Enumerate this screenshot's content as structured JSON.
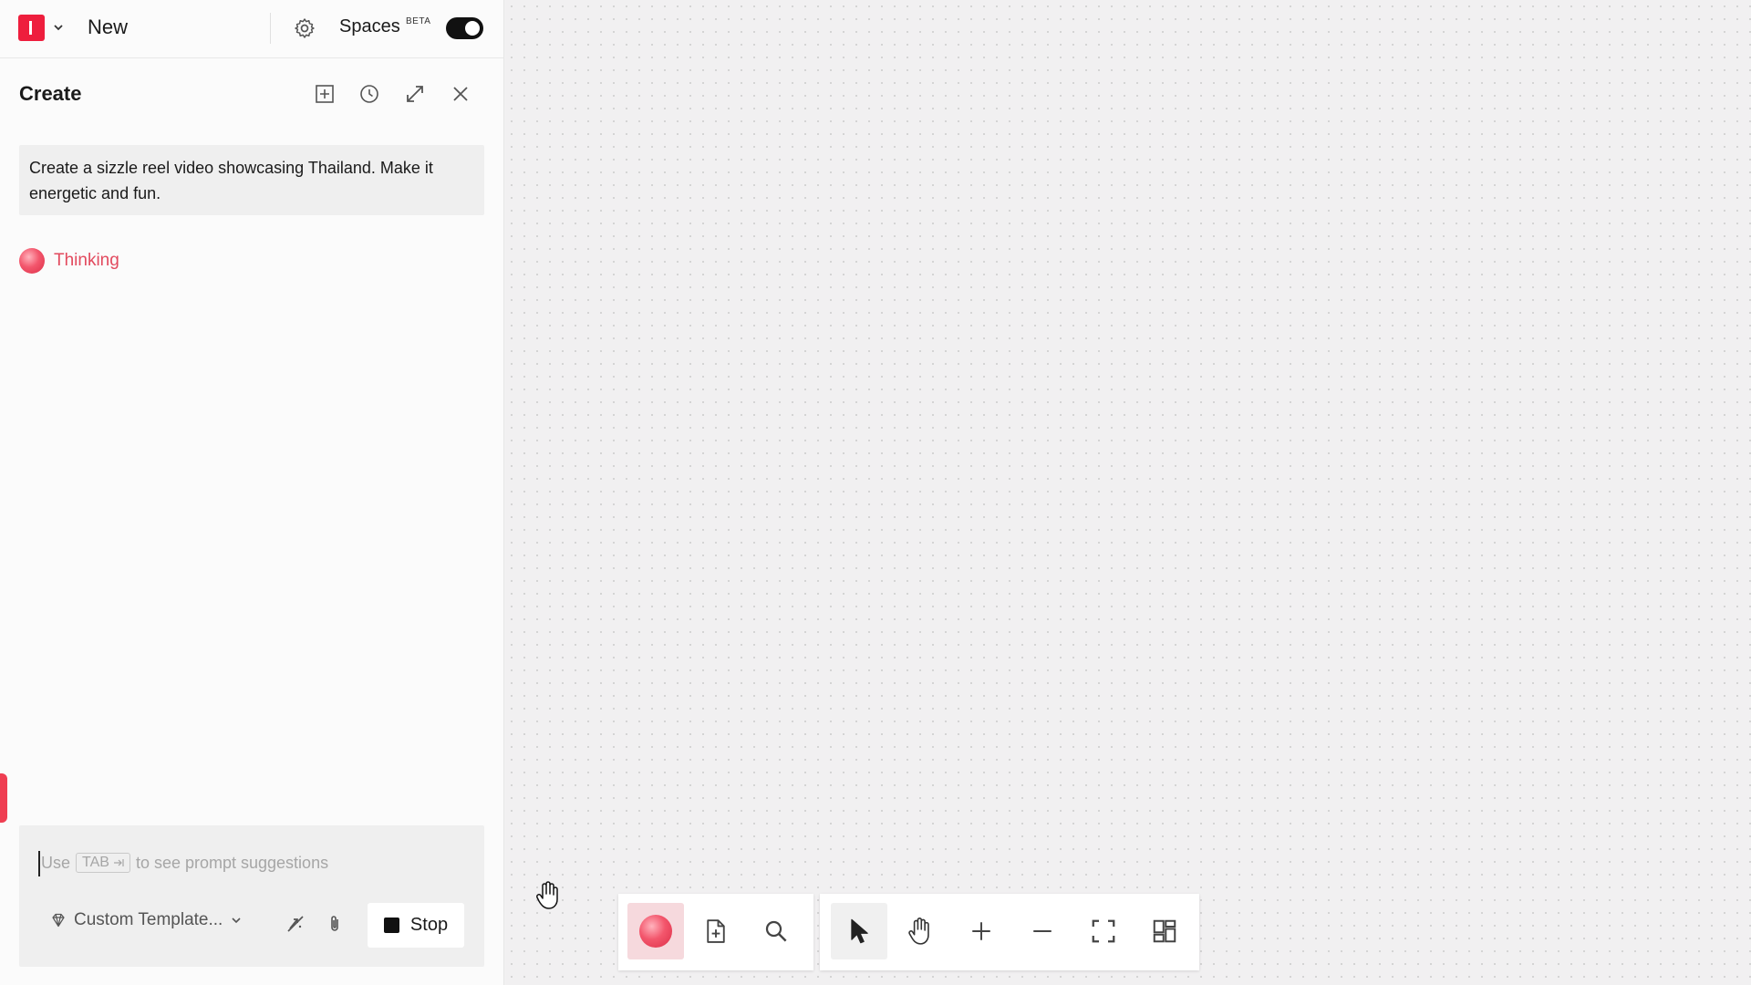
{
  "topbar": {
    "project_name": "New",
    "spaces_label": "Spaces",
    "spaces_badge": "BETA",
    "spaces_enabled": true
  },
  "panel": {
    "title": "Create",
    "header_icons": [
      "add-frame-icon",
      "history-icon",
      "expand-icon",
      "close-icon"
    ]
  },
  "chat": {
    "user_message": "Create a sizzle reel video showcasing Thailand. Make it energetic and fun.",
    "status_text": "Thinking"
  },
  "composer": {
    "placeholder_prefix": "Use",
    "placeholder_key": "TAB",
    "placeholder_suffix": "to see prompt suggestions",
    "template_label": "Custom Template...",
    "stop_label": "Stop"
  },
  "toolbar": {
    "group1": [
      "assistant-orb",
      "add-document-icon",
      "search-icon"
    ],
    "group2": [
      "pointer-icon",
      "hand-icon",
      "zoom-in-icon",
      "zoom-out-icon",
      "fit-screen-icon",
      "grid-layout-icon"
    ]
  },
  "colors": {
    "brand": "#ee1e3d",
    "thinking": "#e24a5e",
    "canvas_bg": "#f1f0f1"
  }
}
